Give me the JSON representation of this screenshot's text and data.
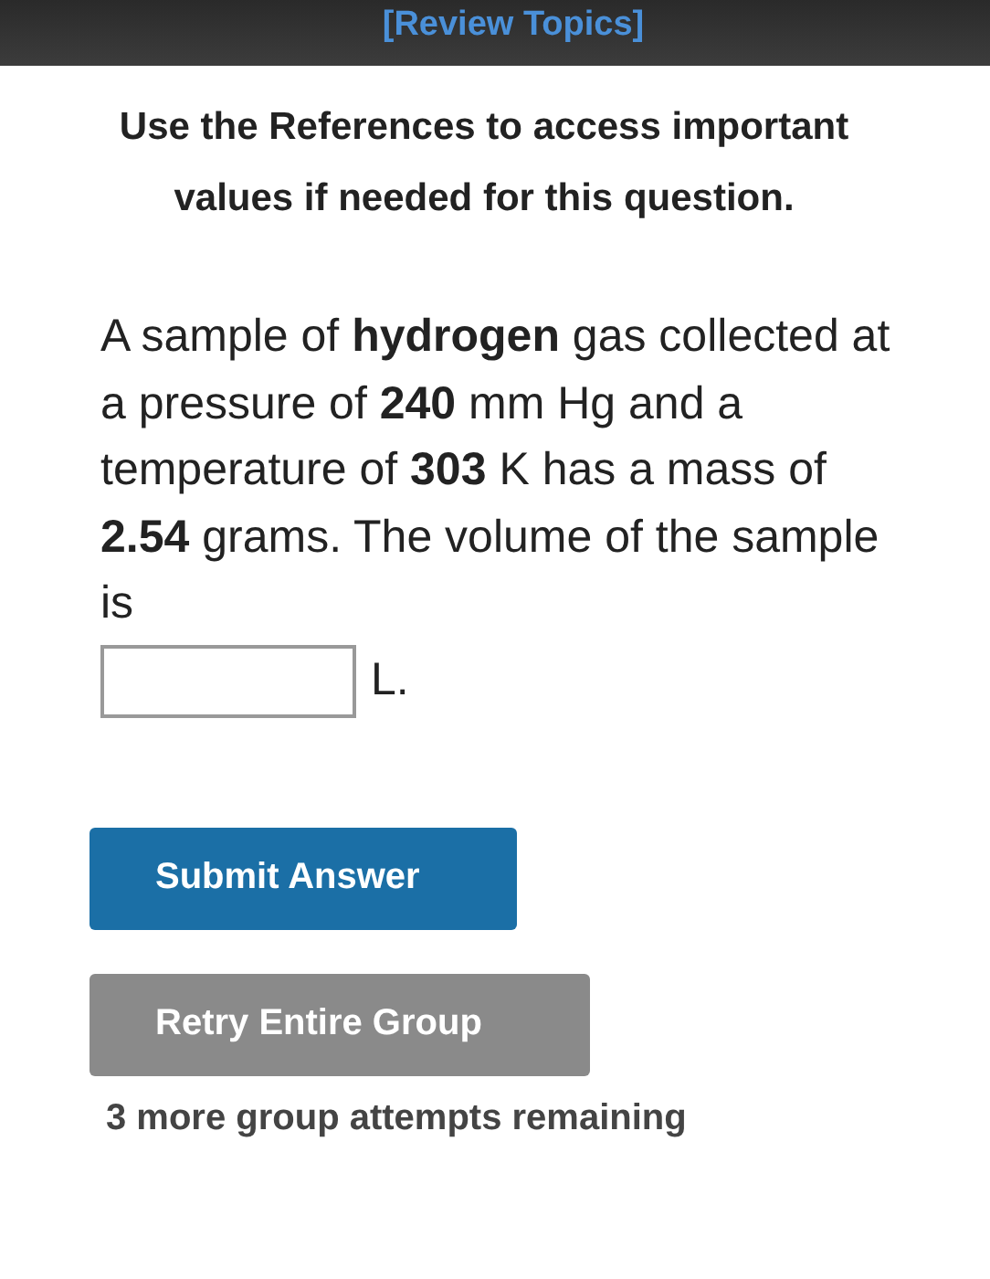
{
  "header": {
    "link": "[Review Topics]"
  },
  "instructions": "Use the References to access important values if needed for this question.",
  "question": {
    "text": "A sample of **hydrogen** gas collected at a pressure of **240** mm Hg and a temperature of **303** K has a mass of **2.54** grams. The volume of the sample is",
    "unit": "L."
  },
  "buttons": [
    {
      "label": "Submit Answer",
      "kind": "primary"
    },
    {
      "label": "Retry Entire Group",
      "kind": "secondary"
    }
  ],
  "attempts": "3 more group attempts remaining"
}
